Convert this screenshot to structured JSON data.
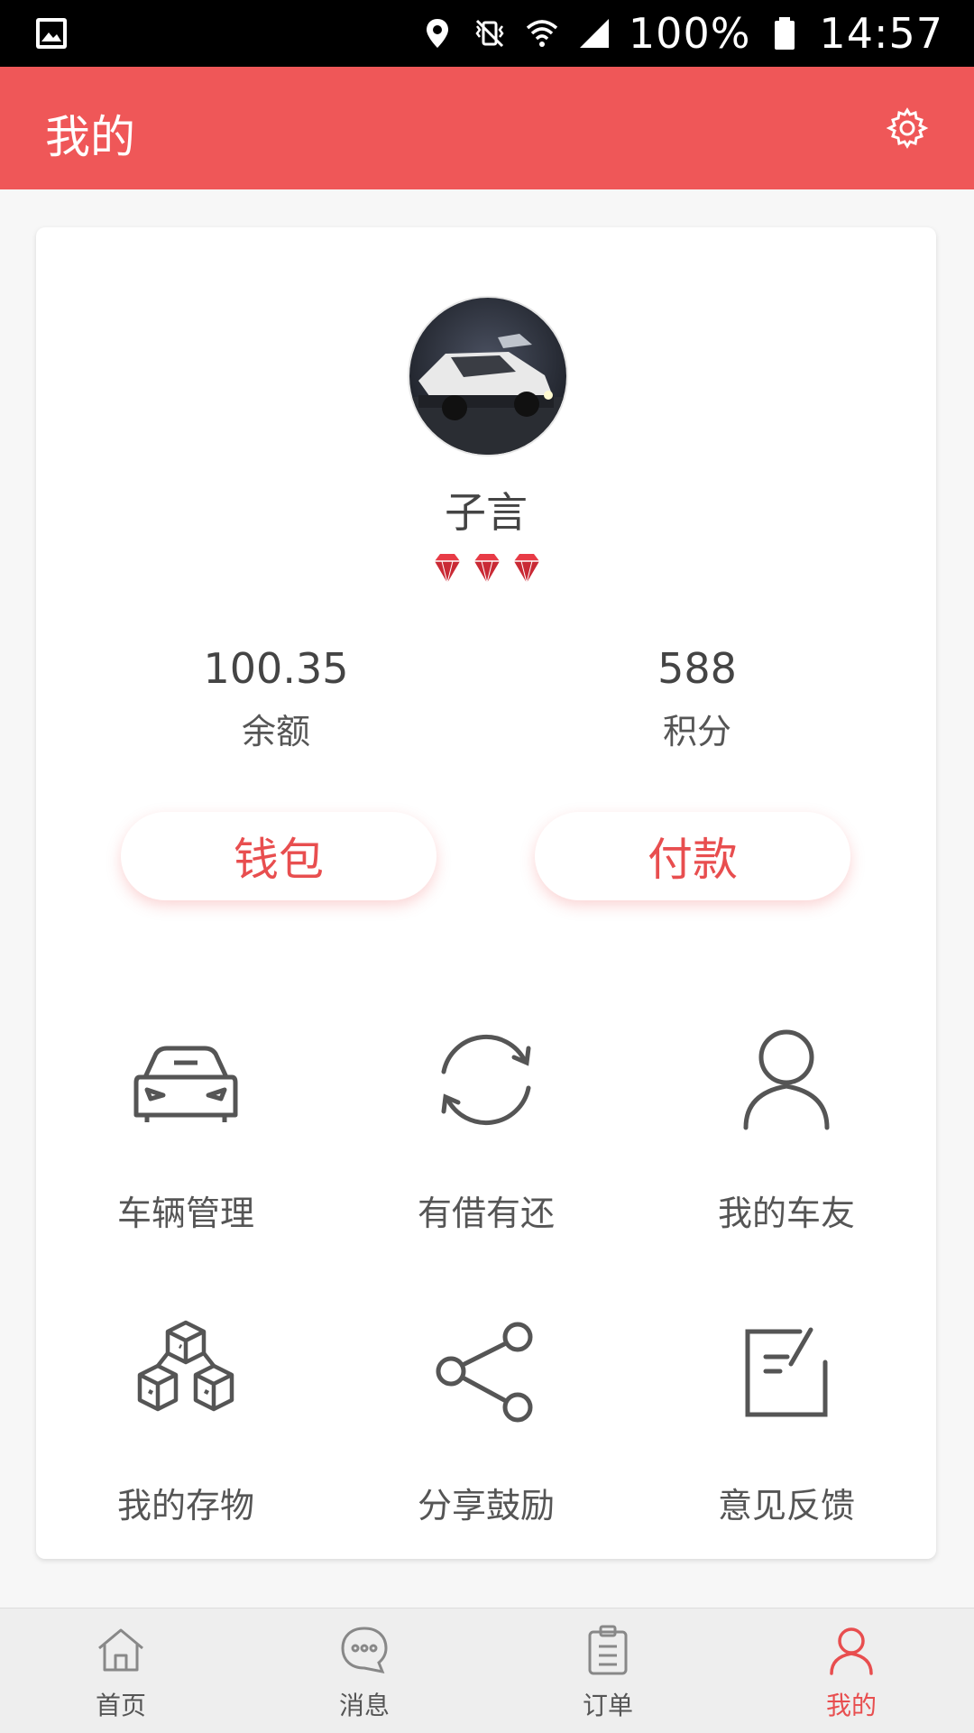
{
  "status_bar": {
    "battery_text": "100%",
    "time": "14:57",
    "icons": [
      "gallery-icon",
      "location-icon",
      "vibrate-icon",
      "wifi-icon",
      "signal-icon",
      "battery-icon"
    ]
  },
  "header": {
    "title": "我的",
    "settings_icon": "gear-icon",
    "color": "#ef5758"
  },
  "profile": {
    "name": "子言",
    "gems_count": 3,
    "avatar_icon": "car-photo-avatar"
  },
  "stats": {
    "balance": {
      "value": "100.35",
      "label": "余额"
    },
    "points": {
      "value": "588",
      "label": "积分"
    }
  },
  "buttons": {
    "wallet": "钱包",
    "pay": "付款"
  },
  "grid": [
    {
      "label": "车辆管理",
      "icon": "car-icon"
    },
    {
      "label": "有借有还",
      "icon": "refresh-icon"
    },
    {
      "label": "我的车友",
      "icon": "user-icon"
    },
    {
      "label": "我的存物",
      "icon": "boxes-icon"
    },
    {
      "label": "分享鼓励",
      "icon": "share-icon"
    },
    {
      "label": "意见反馈",
      "icon": "feedback-icon"
    }
  ],
  "bottom_nav": [
    {
      "label": "首页",
      "icon": "home-icon"
    },
    {
      "label": "消息",
      "icon": "message-icon"
    },
    {
      "label": "订单",
      "icon": "clipboard-icon"
    },
    {
      "label": "我的",
      "icon": "person-icon",
      "active": true
    }
  ]
}
